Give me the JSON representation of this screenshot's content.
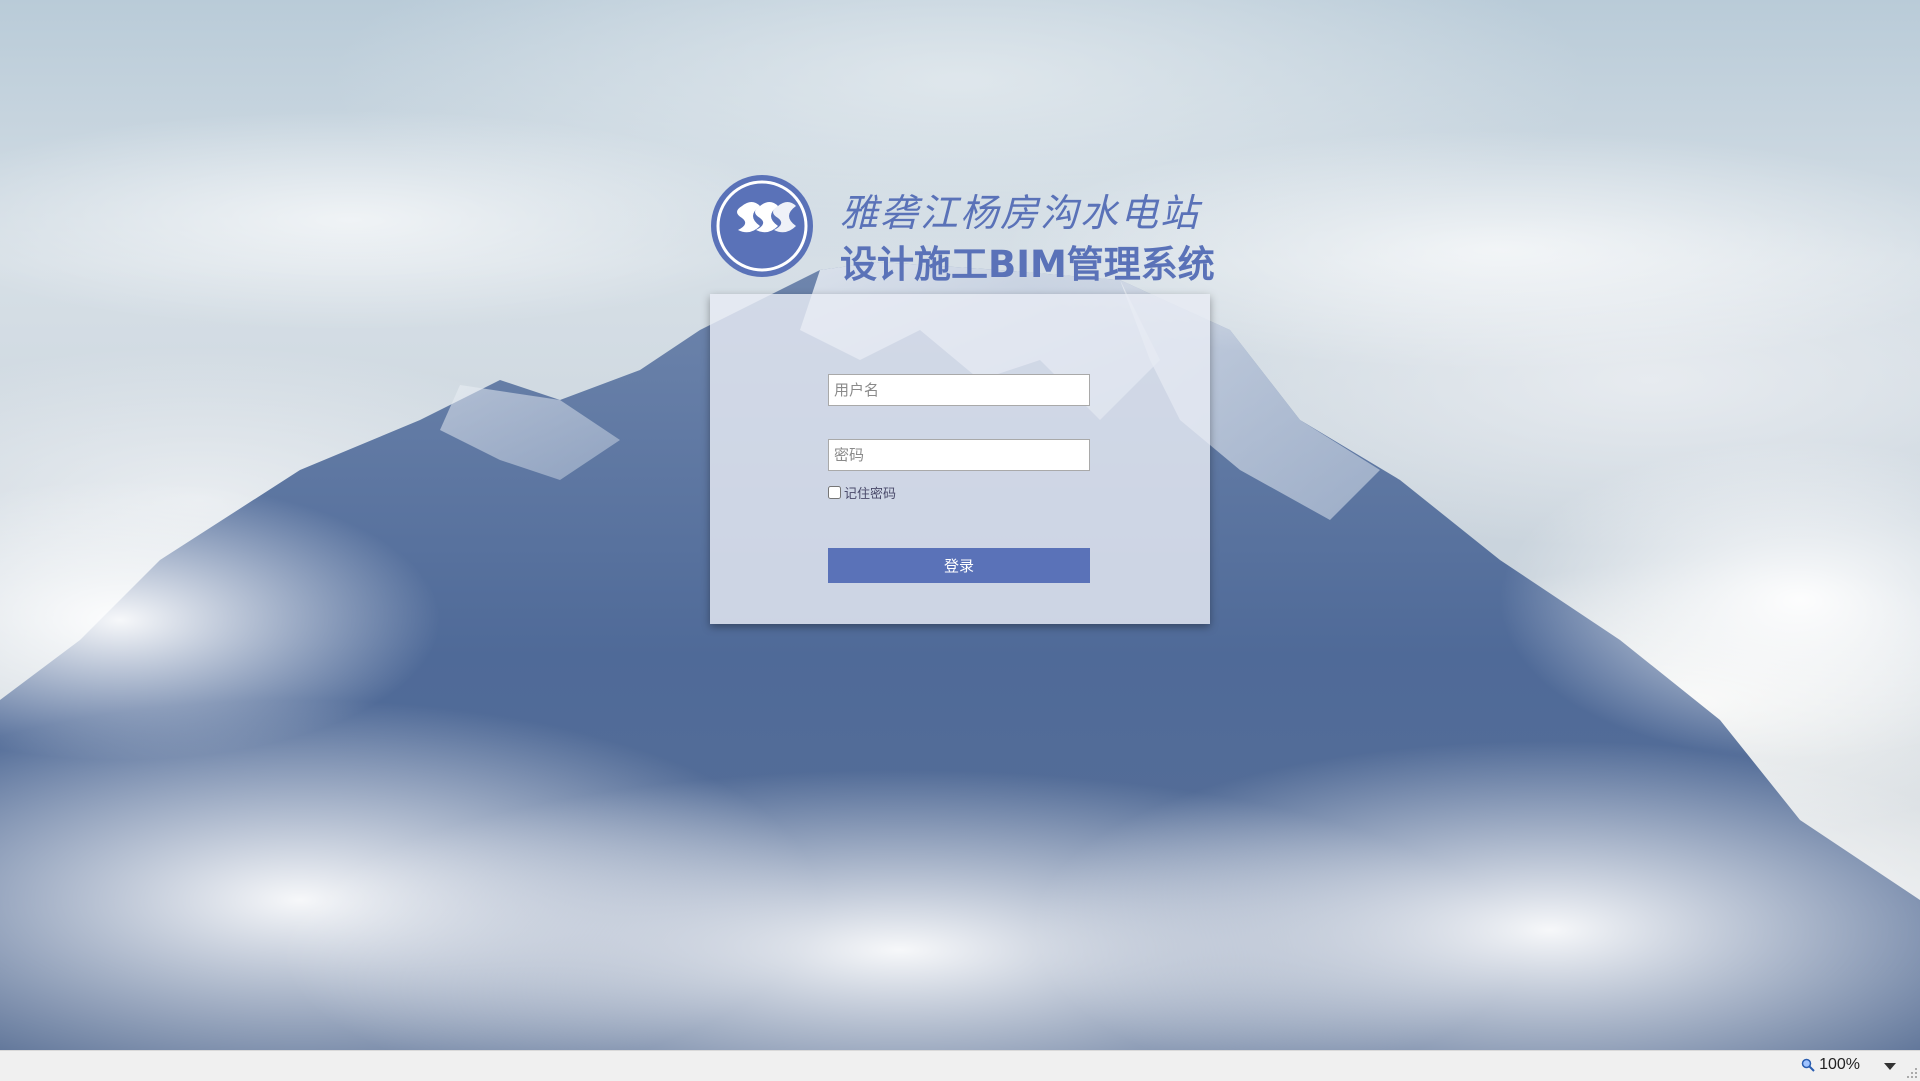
{
  "brand": {
    "title_line1": "雅砻江杨房沟水电站",
    "title_line2": "设计施工BIM管理系统",
    "logo_icon": "company-logo-icon"
  },
  "login": {
    "username_placeholder": "用户名",
    "password_placeholder": "密码",
    "remember_label": "记住密码",
    "submit_label": "登录"
  },
  "statusbar": {
    "zoom_level": "100%",
    "zoom_icon": "magnifier-icon",
    "dropdown_icon": "chevron-down-icon",
    "grip_icon": "resize-grip-icon"
  },
  "colors": {
    "accent": "#5a72b8",
    "card_bg": "#e8ecf4"
  }
}
